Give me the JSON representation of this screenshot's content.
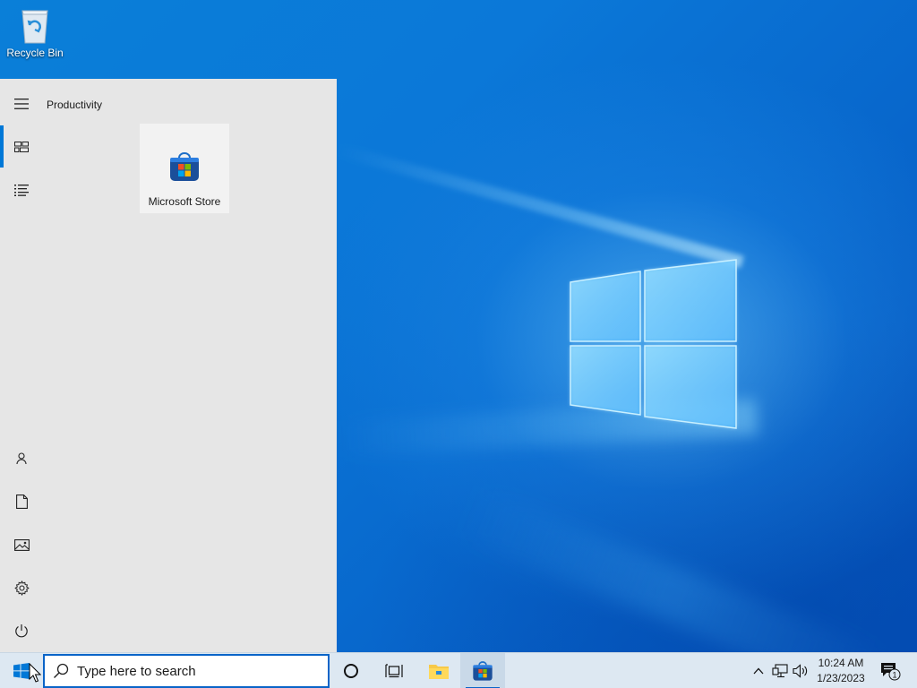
{
  "desktop": {
    "icons": [
      {
        "label": "Recycle Bin",
        "icon": "recycle-bin-icon"
      }
    ]
  },
  "start_menu": {
    "group_title": "Productivity",
    "tiles": [
      {
        "label": "Microsoft Store",
        "icon": "microsoft-store-icon"
      }
    ],
    "rail": {
      "top": [
        "hamburger-menu-icon",
        "tiles-view-icon",
        "all-apps-list-icon"
      ],
      "bottom": [
        "user-icon",
        "documents-icon",
        "pictures-icon",
        "settings-icon",
        "power-icon"
      ],
      "active": "tiles-view-icon"
    }
  },
  "taskbar": {
    "search_placeholder": "Type here to search",
    "buttons": [
      "start-button",
      "cortana-icon",
      "task-view-icon"
    ],
    "pinned_apps": [
      {
        "name": "File Explorer",
        "icon": "file-explorer-icon"
      },
      {
        "name": "Microsoft Store",
        "icon": "microsoft-store-icon"
      }
    ],
    "tray": {
      "icons": [
        "show-hidden-icons-chevron",
        "network-icon",
        "volume-icon"
      ],
      "time": "10:24 AM",
      "date": "1/23/2023",
      "notifications_count": "1"
    }
  },
  "colors": {
    "accent": "#0078d7",
    "start_menu_bg": "#e6e6e6",
    "taskbar_bg": "#dde8f2"
  }
}
